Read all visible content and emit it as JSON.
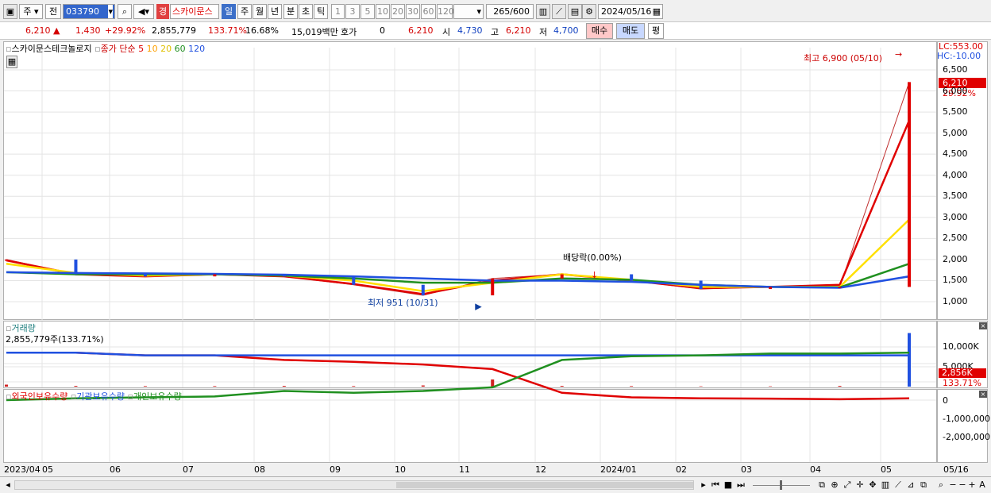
{
  "toolbar": {
    "period_type": "주",
    "compare": "전",
    "code": "033790",
    "stock_name_badge": "경",
    "stock_name": "스카이문스",
    "interval_buttons": [
      "일",
      "주",
      "월",
      "년",
      "분",
      "초",
      "틱"
    ],
    "number_buttons": [
      "1",
      "3",
      "5",
      "10",
      "20",
      "30",
      "60",
      "120"
    ],
    "count": "265",
    "count_total": "/600",
    "date": "2024/05/16"
  },
  "quote": {
    "price": "6,210",
    "change": "1,430",
    "change_pct": "+29.92%",
    "volume": "2,855,779",
    "volume_ratio": "133.71%",
    "turnover": "16.68%",
    "amount": "15,019백만",
    "hoga_label": "호가",
    "hoga_value": "0",
    "hoga_price": "6,210",
    "open_label": "시",
    "open": "4,730",
    "high_label": "고",
    "high": "6,210",
    "low_label": "저",
    "low": "4,700",
    "buy_label": "매수",
    "sell_label": "매도",
    "eval_label": "평"
  },
  "price_panel": {
    "legend_name": "스카이문스테크놀로지",
    "legend_ma": "종가 단순",
    "ma_periods": [
      "5",
      "10",
      "20",
      "60",
      "120"
    ],
    "ma_colors": [
      "#e00000",
      "#ffa000",
      "#ffe000",
      "#209020",
      "#2050e0"
    ],
    "lc": "LC:553.00",
    "hc": "HC:-10.00",
    "current_price": "6,210",
    "current_pct": "29.92%",
    "high_annotation": "최고 6,900 (05/10)",
    "low_annotation": "최저 951 (10/31)",
    "dividend_annotation": "배당락(0.00%)",
    "y_ticks": [
      "6,500",
      "6,000",
      "5,500",
      "5,000",
      "4,500",
      "4,000",
      "3,500",
      "3,000",
      "2,500",
      "2,000",
      "1,500",
      "1,000"
    ]
  },
  "volume_panel": {
    "title": "거래량",
    "value": "2,855,779주(133.71%)",
    "current": "2,856K",
    "current_pct": "133.71%",
    "y_ticks": [
      "10,000K",
      "5,000K"
    ]
  },
  "holdings_panel": {
    "legend": [
      "외국인보유수량",
      "기관보유수량",
      "개인보유수량"
    ],
    "colors": [
      "#e00000",
      "#2050e0",
      "#209020"
    ],
    "y_ticks": [
      "0",
      "-1,000,000",
      "-2,000,000"
    ]
  },
  "x_axis": [
    "2023/04",
    "05",
    "06",
    "07",
    "08",
    "09",
    "10",
    "11",
    "12",
    "2024/01",
    "02",
    "03",
    "04",
    "05",
    "05/16"
  ],
  "chart_data": {
    "type": "line",
    "title": "스카이문스테크놀로지",
    "x": [
      "2023/04",
      "2023/05",
      "2023/06",
      "2023/07",
      "2023/08",
      "2023/09",
      "2023/10",
      "2023/11",
      "2023/12",
      "2024/01",
      "2024/02",
      "2024/03",
      "2024/04",
      "2024/05/16"
    ],
    "series": [
      {
        "name": "종가",
        "values": [
          2000,
          1650,
          1600,
          1650,
          1600,
          1400,
          1150,
          1550,
          1650,
          1500,
          1300,
          1350,
          1350,
          6210
        ]
      },
      {
        "name": "5",
        "values": [
          1980,
          1650,
          1600,
          1650,
          1600,
          1420,
          1180,
          1500,
          1650,
          1500,
          1320,
          1350,
          1400,
          5300
        ]
      },
      {
        "name": "20",
        "values": [
          1900,
          1680,
          1620,
          1650,
          1620,
          1500,
          1250,
          1450,
          1650,
          1520,
          1350,
          1350,
          1350,
          2950
        ]
      },
      {
        "name": "60",
        "values": [
          1700,
          1650,
          1650,
          1650,
          1620,
          1550,
          1450,
          1450,
          1550,
          1520,
          1400,
          1350,
          1340,
          1900
        ]
      },
      {
        "name": "120",
        "values": [
          1700,
          1680,
          1670,
          1660,
          1640,
          1600,
          1550,
          1500,
          1500,
          1470,
          1400,
          1350,
          1330,
          1600
        ]
      }
    ],
    "ylim": [
      900,
      6900
    ],
    "volume_k": [
      500,
      200,
      150,
      150,
      200,
      150,
      300,
      1800,
      200,
      150,
      100,
      100,
      200,
      13500
    ],
    "holdings": [
      {
        "name": "외국인보유수량",
        "values": [
          -2600000,
          -2600000,
          -2450000,
          -2450000,
          -2200000,
          -2100000,
          -1950000,
          -1700000,
          -400000,
          -150000,
          -100000,
          -80000,
          -50000,
          -100000
        ]
      },
      {
        "name": "기관보유수량",
        "values": [
          -2600000,
          -2600000,
          -2450000,
          -2450000,
          -2450000,
          -2450000,
          -2450000,
          -2450000,
          -2450000,
          -2450000,
          -2450000,
          -2450000,
          -2450000,
          -2450000
        ]
      },
      {
        "name": "개인보유수량",
        "values": [
          0,
          -100000,
          -150000,
          -200000,
          -500000,
          -400000,
          -500000,
          -700000,
          -2200000,
          -2400000,
          -2450000,
          -2550000,
          -2550000,
          -2600000
        ]
      }
    ]
  }
}
